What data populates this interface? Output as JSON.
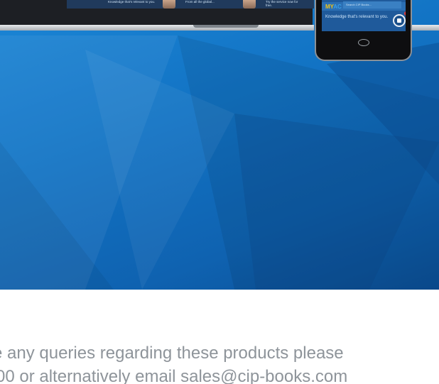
{
  "hero": {
    "laptop_tiles": [
      {
        "text": "Knowledge that's relevant to you."
      },
      {
        "text": "From all the global..."
      },
      {
        "text": "Try the service now for free."
      }
    ],
    "phone": {
      "brand_part1": "MY",
      "brand_part2": "AC",
      "search_placeholder": "Search CIP Books...",
      "tagline": "Knowledge that's relevant to you."
    }
  },
  "footer": {
    "line1": "e any queries regarding these products please",
    "line2": "00 or alternatively email sales@cip-books.com"
  },
  "colors": {
    "hero_blue": "#1273c4",
    "footer_text": "#8e949a",
    "brand_yellow": "#f0c419"
  }
}
